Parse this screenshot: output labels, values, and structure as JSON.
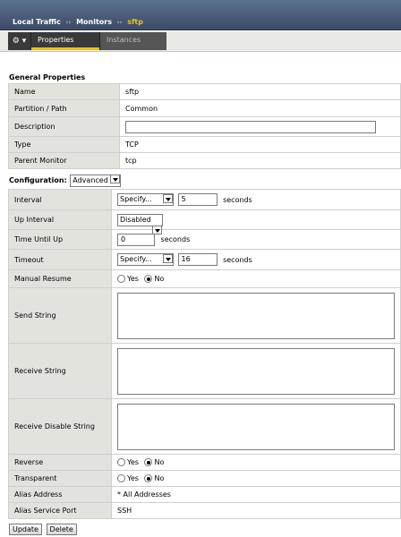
{
  "breadcrumb": {
    "item1": "Local Traffic",
    "item2": "Monitors",
    "current": "sftp",
    "separator": "››"
  },
  "tabs": {
    "gear": "⚙ ▾",
    "properties": "Properties",
    "instances": "Instances"
  },
  "general": {
    "title": "General Properties",
    "rows": {
      "name": {
        "label": "Name",
        "value": "sftp"
      },
      "partition": {
        "label": "Partition / Path",
        "value": "Common"
      },
      "description": {
        "label": "Description",
        "value": ""
      },
      "type": {
        "label": "Type",
        "value": "TCP"
      },
      "parent": {
        "label": "Parent Monitor",
        "value": "tcp"
      }
    }
  },
  "configuration": {
    "label": "Configuration:",
    "mode": "Advanced",
    "interval": {
      "label": "Interval",
      "select": "Specify...",
      "value": "5",
      "unit": "seconds"
    },
    "up_interval": {
      "label": "Up Interval",
      "select": "Disabled"
    },
    "time_until_up": {
      "label": "Time Until Up",
      "value": "0",
      "unit": "seconds"
    },
    "timeout": {
      "label": "Timeout",
      "select": "Specify...",
      "value": "16",
      "unit": "seconds"
    },
    "manual_resume": {
      "label": "Manual Resume",
      "yes": "Yes",
      "no": "No",
      "selected": "No"
    },
    "send_string": {
      "label": "Send String",
      "value": ""
    },
    "receive_string": {
      "label": "Receive String",
      "value": ""
    },
    "receive_disable_string": {
      "label": "Receive Disable String",
      "value": ""
    },
    "reverse": {
      "label": "Reverse",
      "yes": "Yes",
      "no": "No",
      "selected": "No"
    },
    "transparent": {
      "label": "Transparent",
      "yes": "Yes",
      "no": "No",
      "selected": "No"
    },
    "alias_address": {
      "label": "Alias Address",
      "value": "* All Addresses"
    },
    "alias_service_port": {
      "label": "Alias Service Port",
      "value": "SSH"
    }
  },
  "buttons": {
    "update": "Update",
    "delete": "Delete"
  },
  "colors": {
    "accent": "#f2c200",
    "header": "#4a5a78",
    "label_bg": "#e3e3de"
  }
}
